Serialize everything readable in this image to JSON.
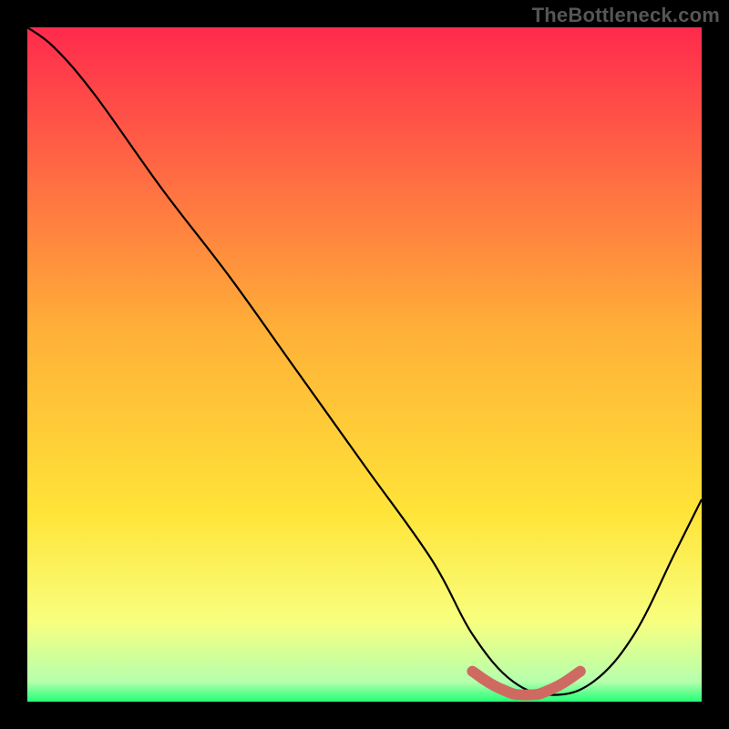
{
  "watermark": "TheBottleneck.com",
  "chart_data": {
    "type": "line",
    "title": "",
    "xlabel": "",
    "ylabel": "",
    "xlim": [
      0,
      100
    ],
    "ylim": [
      0,
      100
    ],
    "grid": false,
    "legend": false,
    "background_gradient": {
      "top_color": "#ff2a4d",
      "mid_color": "#ffe438",
      "lowmid_color": "#f8ff7e",
      "bottom_color": "#22ff77"
    },
    "series": [
      {
        "name": "bottleneck-curve",
        "color": "#000000",
        "x": [
          0,
          4,
          10,
          20,
          30,
          40,
          50,
          60,
          66,
          72,
          78,
          84,
          90,
          96,
          100
        ],
        "y": [
          100,
          97,
          90,
          76,
          63,
          49,
          35,
          21,
          10,
          3,
          1,
          3,
          10,
          22,
          30
        ]
      }
    ],
    "highlight": {
      "name": "minimum-region",
      "color": "#cf6a62",
      "x": [
        66,
        70,
        74,
        78,
        82
      ],
      "y": [
        4.5,
        2.0,
        1.0,
        2.0,
        4.5
      ]
    }
  }
}
